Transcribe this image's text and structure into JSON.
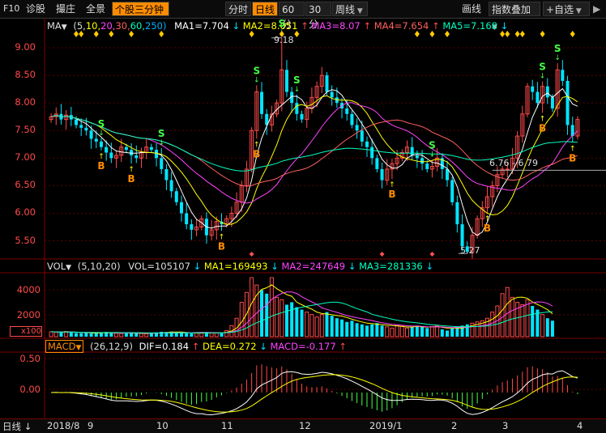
{
  "toolbar": {
    "f10": "F10",
    "diagnose": "诊股",
    "bid": "撮庄",
    "panorama": "全景",
    "minute3": "个股三分钟",
    "fenshi": "分时",
    "rixian": "日线",
    "m60": "60分",
    "m30": "30分",
    "zhouxian": "周线",
    "huaxian": "画线",
    "index_overlay": "指数叠加",
    "add_watch": "+自选"
  },
  "ma_row": {
    "name": "MA",
    "params_prefix": "(5,",
    "p10": "10,",
    "p20": "20,",
    "p30": "30,",
    "p60": "60,",
    "p250": "250)",
    "ma1": "MA1=7.704",
    "ma2": "MA2=8.051",
    "ma3": "MA3=8.07",
    "ma4": "MA4=7.654",
    "ma5": "MA5=7.168"
  },
  "vol_row": {
    "name": "VOL",
    "params": "(5,10,20)",
    "vol": "VOL=105107",
    "ma1": "MA1=169493",
    "ma2": "MA2=247649",
    "ma3": "MA3=281336"
  },
  "macd_row": {
    "name": "MACD",
    "params": "(26,12,9)",
    "dif": "DIF=0.184",
    "dea": "DEA=0.272",
    "macd": "MACD=-0.177"
  },
  "price_axis": [
    "9.00",
    "8.50",
    "8.00",
    "7.50",
    "7.00",
    "6.50",
    "6.00",
    "5.50"
  ],
  "vol_axis": [
    "4000",
    "2000",
    "x100"
  ],
  "macd_axis": [
    "0.50",
    "0.00"
  ],
  "annotations": {
    "high": "9.18",
    "low": "5.27",
    "range": "6.76 - 6.79"
  },
  "signals": {
    "buy": "B",
    "sell": "S"
  },
  "bottom_bar": {
    "period": "日线",
    "dates": [
      "2018/8",
      "9",
      "10",
      "11",
      "12",
      "2019/1",
      "2",
      "3",
      "4"
    ]
  },
  "colors": {
    "up": "#ff4a4a",
    "down": "#00e5ff",
    "ma1": "#ffffff",
    "ma2": "#ffff00",
    "ma3": "#ff44ff",
    "ma4": "#ff6060",
    "ma5": "#00ffc0",
    "accent": "#ff8c00"
  },
  "chart_data": [
    {
      "type": "candlestick",
      "title": "",
      "ylim": [
        5.2,
        9.25
      ],
      "ma_last": {
        "MA1": 7.704,
        "MA2": 8.051,
        "MA3": 8.07,
        "MA4": 7.654,
        "MA5": 7.168
      },
      "closes": [
        7.75,
        7.8,
        7.7,
        7.78,
        7.7,
        7.6,
        7.55,
        7.5,
        7.35,
        7.3,
        7.2,
        7.1,
        7.0,
        7.05,
        7.2,
        7.15,
        7.05,
        7.0,
        7.1,
        7.2,
        7.15,
        7.0,
        6.8,
        6.6,
        6.4,
        6.2,
        6.0,
        5.8,
        5.7,
        5.75,
        5.9,
        5.6,
        5.7,
        5.85,
        5.8,
        5.9,
        6.0,
        6.2,
        6.5,
        6.8,
        7.5,
        8.2,
        7.8,
        7.6,
        7.8,
        8.0,
        8.6,
        8.2,
        8.0,
        7.8,
        7.7,
        7.9,
        8.1,
        8.3,
        8.5,
        8.2,
        8.1,
        8.0,
        7.9,
        7.8,
        7.6,
        7.5,
        7.3,
        7.2,
        7.0,
        6.8,
        6.6,
        6.8,
        6.9,
        7.0,
        7.1,
        7.2,
        7.05,
        7.0,
        6.9,
        6.8,
        6.85,
        7.0,
        6.8,
        6.6,
        6.2,
        5.8,
        5.4,
        5.3,
        5.6,
        5.9,
        6.1,
        6.3,
        6.5,
        6.7,
        6.8,
        6.8,
        7.0,
        7.4,
        7.8,
        8.3,
        8.2,
        8.0,
        8.3,
        8.1,
        7.9,
        8.6,
        8.4,
        7.6,
        7.4,
        7.7
      ]
    },
    {
      "type": "bar",
      "title": "",
      "ylim": [
        0,
        5000
      ],
      "values_x100": [
        400,
        380,
        350,
        420,
        360,
        300,
        280,
        320,
        260,
        300,
        340,
        380,
        300,
        280,
        260,
        320,
        300,
        280,
        260,
        240,
        300,
        350,
        400,
        380,
        420,
        360,
        300,
        280,
        260,
        300,
        340,
        380,
        320,
        300,
        280,
        500,
        900,
        1500,
        2800,
        3600,
        4800,
        4200,
        3800,
        3500,
        4800,
        3200,
        3000,
        2600,
        2800,
        2400,
        2200,
        2000,
        1800,
        1600,
        1800,
        2000,
        1700,
        1500,
        1400,
        1200,
        1300,
        1100,
        1000,
        900,
        1000,
        1100,
        900,
        800,
        700,
        900,
        850,
        700,
        800,
        900,
        800,
        700,
        800,
        900,
        600,
        500,
        700,
        800,
        900,
        1000,
        1100,
        1200,
        1300,
        1500,
        2000,
        2500,
        3500,
        4000,
        3200,
        2800,
        2600,
        3000,
        2500,
        2200,
        1800,
        1500,
        1300
      ]
    },
    {
      "type": "line",
      "title": "",
      "ylim": [
        -0.5,
        0.8
      ],
      "series": [
        {
          "name": "DIF",
          "last": 0.184
        },
        {
          "name": "DEA",
          "last": 0.272
        },
        {
          "name": "MACD",
          "last": -0.177
        }
      ]
    }
  ]
}
